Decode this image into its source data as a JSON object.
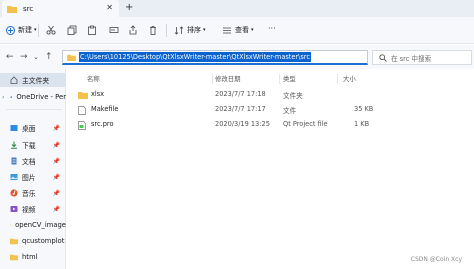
{
  "titlebar": {
    "tab_label": "src",
    "close": "✕",
    "new_tab": "+"
  },
  "commandbar": {
    "new_label": "新建",
    "sort_label": "排序",
    "view_label": "查看",
    "more": "···"
  },
  "address": {
    "path": "C:\\Users\\10125\\Desktop\\QtXlsxWriter-master\\QtXlsxWriter-master\\src",
    "search_placeholder": "在 src 中搜索"
  },
  "sidebar": {
    "items": [
      {
        "label": "主文件夹"
      },
      {
        "label": "OneDrive - Per"
      },
      {
        "label": "桌面"
      },
      {
        "label": "下载"
      },
      {
        "label": "文档"
      },
      {
        "label": "图片"
      },
      {
        "label": "音乐"
      },
      {
        "label": "视频"
      },
      {
        "label": "openCV_image"
      },
      {
        "label": "qcustomplot"
      },
      {
        "label": "html"
      }
    ]
  },
  "list": {
    "columns": [
      "名称",
      "修改日期",
      "类型",
      "大小"
    ],
    "rows": [
      {
        "name": "xlsx",
        "date": "2023/7/7 17:18",
        "type": "文件夹",
        "size": ""
      },
      {
        "name": "Makefile",
        "date": "2023/7/7 17:17",
        "type": "文件",
        "size": "35 KB"
      },
      {
        "name": "src.pro",
        "date": "2020/3/19 13:25",
        "type": "Qt Project file",
        "size": "1 KB"
      }
    ]
  },
  "watermark": "CSDN @Coin Xcy",
  "colors": {
    "accent": "#0a63cf",
    "folder": "#f2c14e",
    "chrome": "#f6f8fb"
  }
}
